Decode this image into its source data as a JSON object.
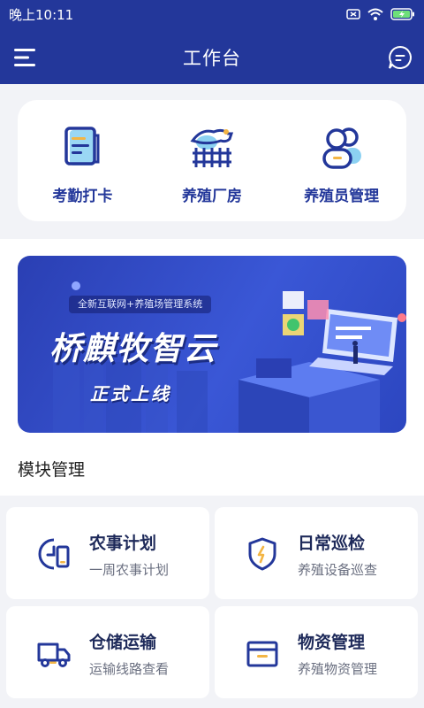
{
  "status_bar": {
    "time": "晚上10:11"
  },
  "header": {
    "title": "工作台"
  },
  "quick_actions": [
    {
      "label": "考勤打卡",
      "icon": "attendance-icon"
    },
    {
      "label": "养殖厂房",
      "icon": "farm-building-icon"
    },
    {
      "label": "养殖员管理",
      "icon": "staff-icon"
    }
  ],
  "banner": {
    "tag": "全新互联网+养殖场管理系统",
    "title": "桥麒牧智云",
    "subtitle": "正式上线"
  },
  "modules_heading": "模块管理",
  "modules": [
    {
      "title": "农事计划",
      "desc": "一周农事计划",
      "icon": "calendar-plan-icon"
    },
    {
      "title": "日常巡检",
      "desc": "养殖设备巡查",
      "icon": "shield-check-icon"
    },
    {
      "title": "仓储运输",
      "desc": "运输线路查看",
      "icon": "truck-icon"
    },
    {
      "title": "物资管理",
      "desc": "养殖物资管理",
      "icon": "box-icon"
    }
  ],
  "colors": {
    "primary": "#23379a",
    "accent": "#f3b544",
    "background": "#f2f3f7"
  }
}
